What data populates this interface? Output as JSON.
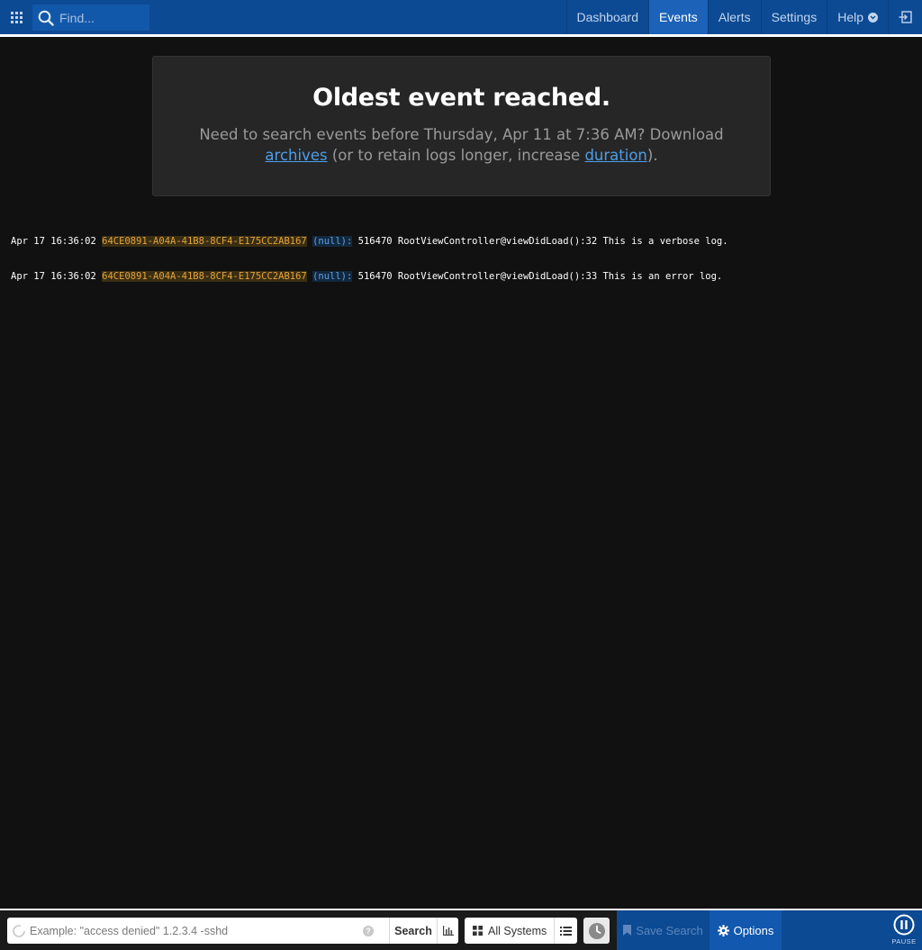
{
  "topbar": {
    "find_placeholder": "Find...",
    "nav": [
      {
        "label": "Dashboard",
        "active": false
      },
      {
        "label": "Events",
        "active": true
      },
      {
        "label": "Alerts",
        "active": false
      },
      {
        "label": "Settings",
        "active": false
      },
      {
        "label": "Help",
        "active": false
      }
    ],
    "icons": {
      "apps": "grid-icon",
      "find": "search-icon",
      "help": "chevron-down-icon",
      "exit": "logout-icon"
    }
  },
  "notice": {
    "title": "Oldest event reached.",
    "text_before": "Need to search events before Thursday, Apr 11 at 7:36 AM? Download ",
    "archives_link": "archives",
    "text_middle": " (or to retain logs longer, increase ",
    "duration_link": "duration",
    "text_after": ")."
  },
  "logs": [
    {
      "timestamp": "Apr 17 16:36:02",
      "system": "64CE0891-A04A-41B8-8CF4-E175CC2AB167",
      "program": "(null):",
      "message": "516470 RootViewController@viewDidLoad():32 This is a verbose log."
    },
    {
      "timestamp": "Apr 17 16:36:02",
      "system": "64CE0891-A04A-41B8-8CF4-E175CC2AB167",
      "program": "(null):",
      "message": "516470 RootViewController@viewDidLoad():33 This is an error log."
    }
  ],
  "bottombar": {
    "search_placeholder": "Example: \"access denied\" 1.2.3.4 -sshd",
    "help_mark": "?",
    "search_label": "Search",
    "systems_label": "All Systems",
    "save_search_label": "Save Search",
    "options_label": "Options",
    "pause_label": "PAUSE"
  },
  "colors": {
    "nav_bg": "#0c4a93",
    "nav_active": "#1b62b8",
    "link": "#4d9eea",
    "system_highlight": "#e3a33a",
    "program_highlight": "#5aa2e8"
  }
}
